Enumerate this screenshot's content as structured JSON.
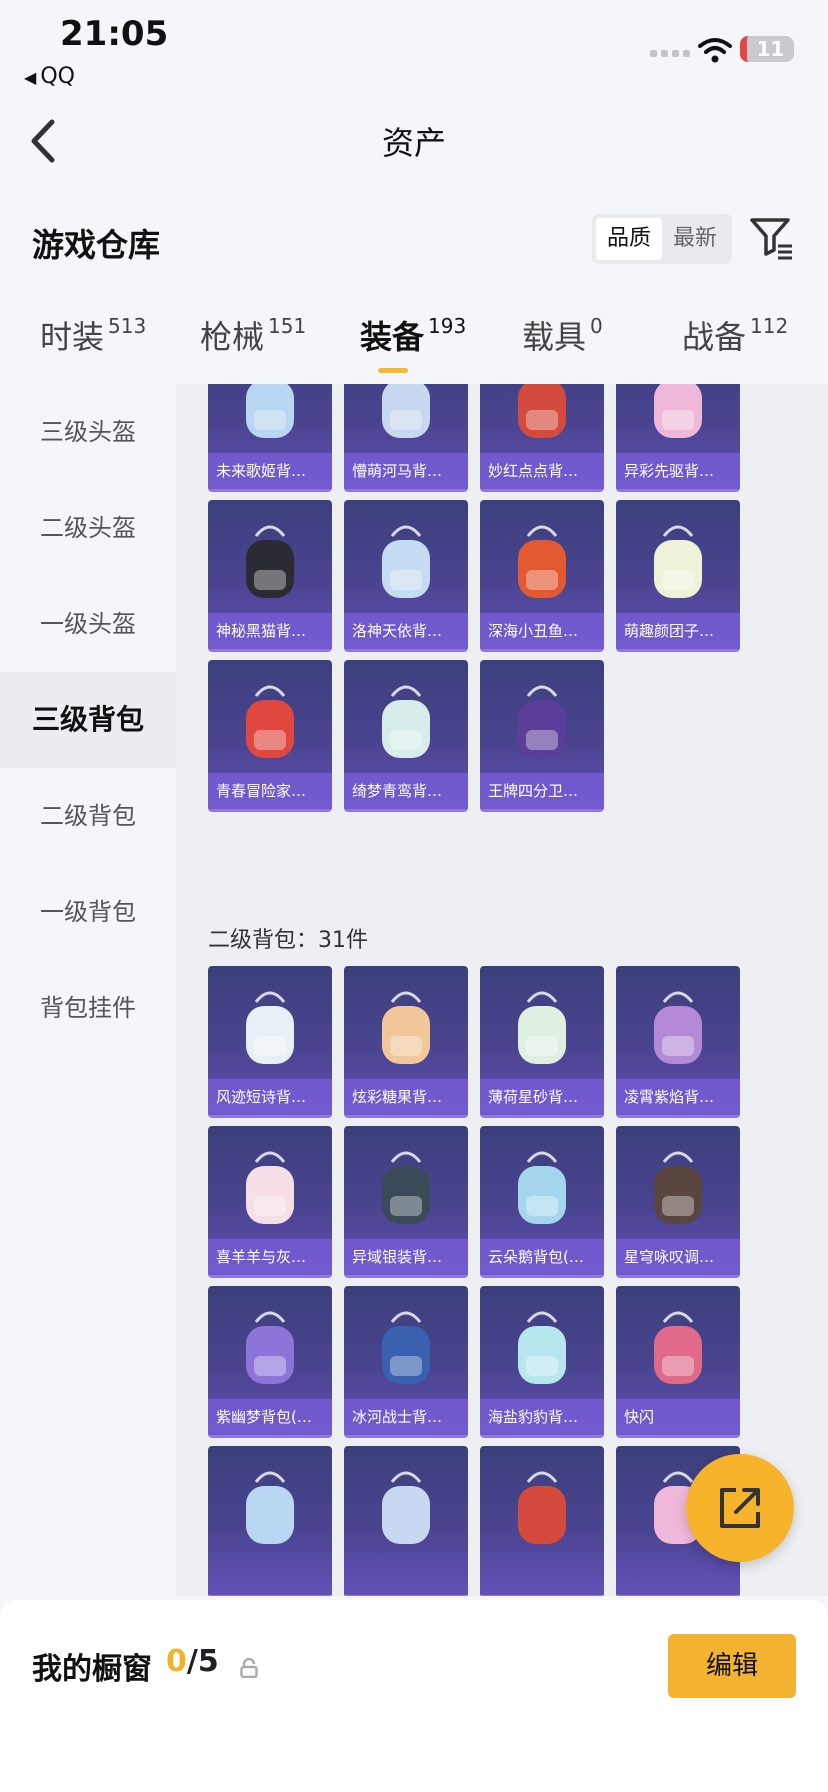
{
  "status_bar": {
    "time": "21:05",
    "back_app": "QQ",
    "battery": "11"
  },
  "nav": {
    "title": "资产"
  },
  "warehouse": {
    "title": "游戏仓库",
    "sort_options": [
      "品质",
      "最新"
    ],
    "sort_selected": "品质"
  },
  "tabs": [
    {
      "label": "时装",
      "count": "513"
    },
    {
      "label": "枪械",
      "count": "151"
    },
    {
      "label": "装备",
      "count": "193",
      "active": true
    },
    {
      "label": "载具",
      "count": "0"
    },
    {
      "label": "战备",
      "count": "112"
    }
  ],
  "sidebar": [
    {
      "label": "三级头盔"
    },
    {
      "label": "二级头盔"
    },
    {
      "label": "一级头盔"
    },
    {
      "label": "三级背包",
      "active": true
    },
    {
      "label": "二级背包"
    },
    {
      "label": "一级背包"
    },
    {
      "label": "背包挂件"
    }
  ],
  "section_level3": {
    "items": [
      {
        "name": "未来歌姬背…"
      },
      {
        "name": "懵萌河马背…"
      },
      {
        "name": "妙红点点背…"
      },
      {
        "name": "异彩先驱背…"
      },
      {
        "name": "神秘黑猫背…"
      },
      {
        "name": "洛神天依背…"
      },
      {
        "name": "深海小丑鱼…"
      },
      {
        "name": "萌趣颜团子…"
      },
      {
        "name": "青春冒险家…"
      },
      {
        "name": "绮梦青鸾背…"
      },
      {
        "name": "王牌四分卫…"
      }
    ]
  },
  "section_level2": {
    "label": "二级背包：31件",
    "items": [
      {
        "name": "风迹短诗背…"
      },
      {
        "name": "炫彩糖果背…"
      },
      {
        "name": "薄荷星砂背…"
      },
      {
        "name": "凌霄紫焰背…"
      },
      {
        "name": "喜羊羊与灰…"
      },
      {
        "name": "异域银装背…"
      },
      {
        "name": "云朵鹅背包(…"
      },
      {
        "name": "星穹咏叹调…"
      },
      {
        "name": "紫幽梦背包(…"
      },
      {
        "name": "冰河战士背…"
      },
      {
        "name": "海盐豹豹背…"
      },
      {
        "name": "快闪"
      }
    ]
  },
  "bottom": {
    "window_label": "我的橱窗",
    "window_current": "0",
    "window_total": "/5",
    "edit_label": "编辑"
  },
  "colors": {
    "accent": "#f3b230",
    "card_top": "#3c3f7c",
    "card_bottom": "#6450b8"
  }
}
